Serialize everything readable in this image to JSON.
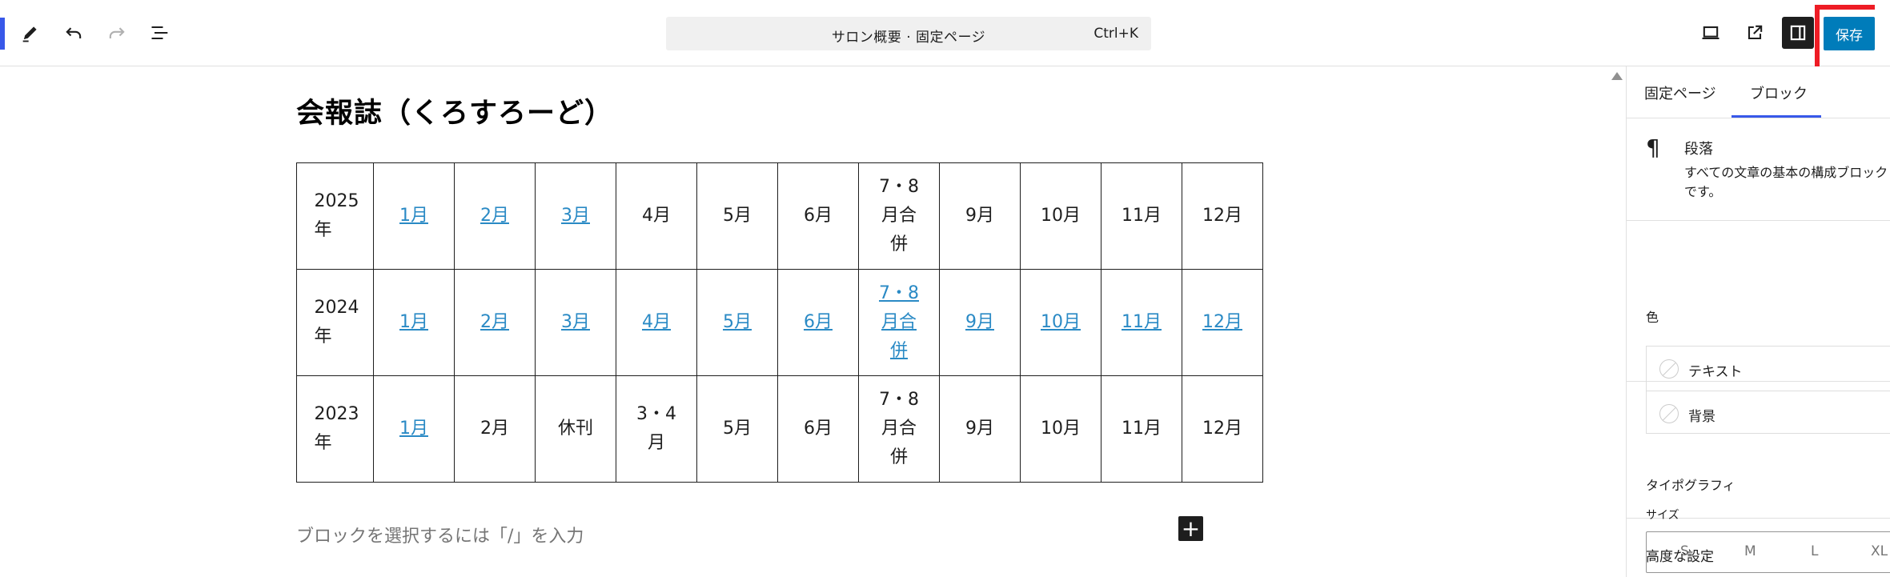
{
  "toolbar": {
    "command_title": "サロン概要 · 固定ページ",
    "command_shortcut": "Ctrl+K",
    "save_label": "保存"
  },
  "content": {
    "heading": "会報誌（くろすろーど）",
    "placeholder": "ブロックを選択するには「/」を入力",
    "add_block": "+"
  },
  "table": {
    "rows": [
      {
        "year": "2025年",
        "cells": [
          {
            "text": "1月",
            "link": true
          },
          {
            "text": "2月",
            "link": true
          },
          {
            "text": "3月",
            "link": true
          },
          {
            "text": "4月",
            "link": false
          },
          {
            "text": "5月",
            "link": false
          },
          {
            "text": "6月",
            "link": false
          },
          {
            "text": "7・8月合併",
            "link": false
          },
          {
            "text": "9月",
            "link": false
          },
          {
            "text": "10月",
            "link": false
          },
          {
            "text": "11月",
            "link": false
          },
          {
            "text": "12月",
            "link": false
          }
        ]
      },
      {
        "year": "2024年",
        "cells": [
          {
            "text": "1月",
            "link": true
          },
          {
            "text": "2月",
            "link": true
          },
          {
            "text": "3月",
            "link": true
          },
          {
            "text": "4月",
            "link": true
          },
          {
            "text": "5月",
            "link": true
          },
          {
            "text": "6月",
            "link": true
          },
          {
            "text": "7・8月合併",
            "link": true
          },
          {
            "text": "9月",
            "link": true
          },
          {
            "text": "10月",
            "link": true
          },
          {
            "text": "11月",
            "link": true
          },
          {
            "text": "12月",
            "link": true
          }
        ]
      },
      {
        "year": "2023年",
        "cells": [
          {
            "text": "1月",
            "link": true
          },
          {
            "text": "2月",
            "link": false
          },
          {
            "text": "休刊",
            "link": false
          },
          {
            "text": "3・4月",
            "link": false
          },
          {
            "text": "5月",
            "link": false
          },
          {
            "text": "6月",
            "link": false
          },
          {
            "text": "7・8月合併",
            "link": false
          },
          {
            "text": "9月",
            "link": false
          },
          {
            "text": "10月",
            "link": false
          },
          {
            "text": "11月",
            "link": false
          },
          {
            "text": "12月",
            "link": false
          }
        ]
      }
    ]
  },
  "sidebar": {
    "tabs": [
      {
        "label": "固定ページ"
      },
      {
        "label": "ブロック"
      }
    ],
    "block": {
      "title": "段落",
      "description": "すべての文章の基本の構成ブロックです。"
    },
    "color": {
      "heading": "色",
      "items": [
        {
          "label": "テキスト"
        },
        {
          "label": "背景"
        }
      ]
    },
    "typography": {
      "heading": "タイポグラフィ",
      "size_label": "サイズ",
      "size_options": [
        "S",
        "M",
        "L",
        "XL"
      ]
    },
    "advanced": {
      "heading": "高度な設定"
    }
  },
  "icons": {
    "logo_accent": "#3858e9",
    "link_color": "#2a8ac5",
    "save_button_color": "#007cba",
    "highlight_color": "#ee1c25"
  }
}
